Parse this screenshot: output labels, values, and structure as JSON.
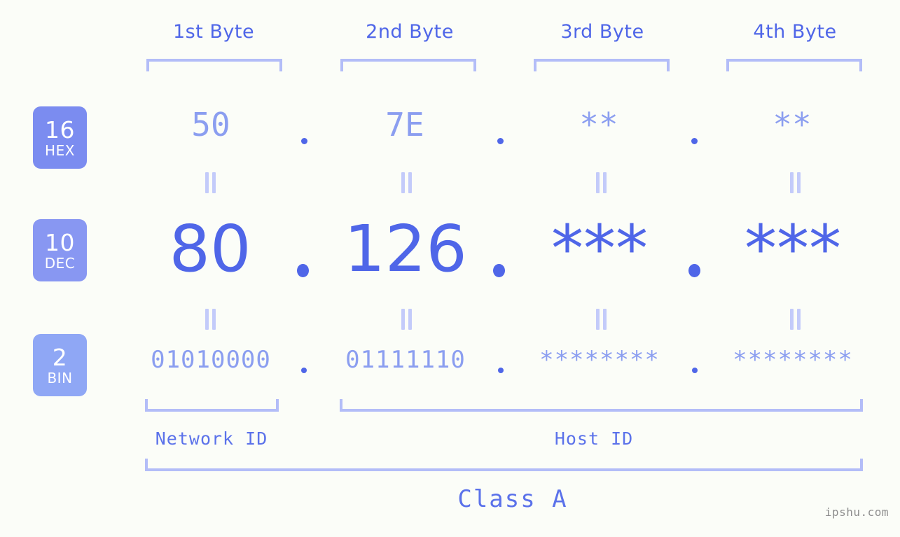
{
  "meta": {
    "background_color": "#fbfdf8",
    "accent_color": "#4f66e8",
    "light_accent_color": "#8b9ef0",
    "bracket_color": "#b3bdf8"
  },
  "byte_headers": [
    {
      "label": "1st Byte"
    },
    {
      "label": "2nd Byte"
    },
    {
      "label": "3rd Byte"
    },
    {
      "label": "4th Byte"
    }
  ],
  "bases": [
    {
      "number": "16",
      "name": "HEX",
      "color": "#7b8cf0"
    },
    {
      "number": "10",
      "name": "DEC",
      "color": "#8897f2"
    },
    {
      "number": "2",
      "name": "BIN",
      "color": "#8fa7f5"
    }
  ],
  "rows": {
    "hex": {
      "values": [
        "50",
        "7E",
        "**",
        "**"
      ],
      "separator": "."
    },
    "dec": {
      "values": [
        "80",
        "126",
        "***",
        "***"
      ],
      "separator": "."
    },
    "bin": {
      "values": [
        "01010000",
        "01111110",
        "********",
        "********"
      ],
      "separator": "."
    }
  },
  "equals_symbol": "=",
  "segments": {
    "network_id": "Network ID",
    "host_id": "Host ID",
    "class": "Class A"
  },
  "watermark": "ipshu.com"
}
